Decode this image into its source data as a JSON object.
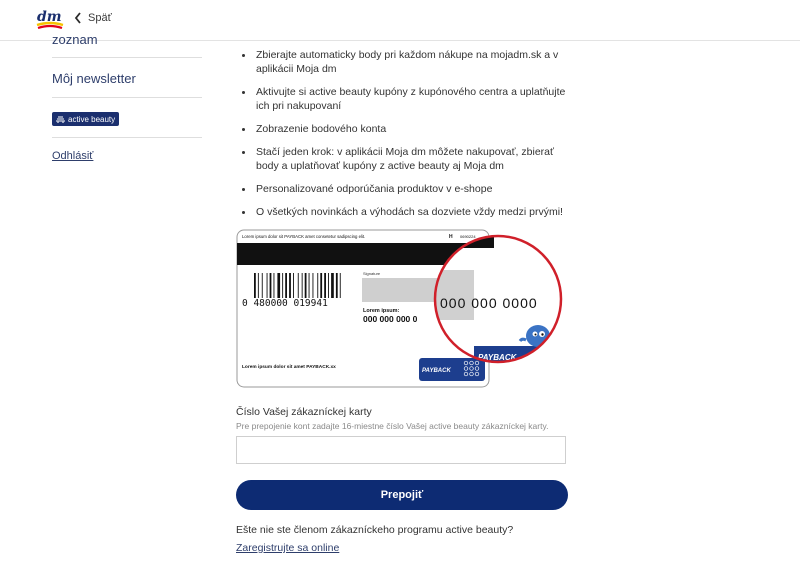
{
  "header": {
    "back_label": "Späť"
  },
  "sidebar": {
    "cut_item_label": "zoznam",
    "newsletter_label": "Môj newsletter",
    "badge_label": "active beauty",
    "logout_label": "Odhlásiť"
  },
  "benefits": [
    "Zbierajte automaticky body pri každom nákupe na mojadm.sk a v aplikácii Moja dm",
    "Aktivujte si active beauty kupóny z kupónového centra a uplatňujte ich pri nakupovaní",
    "Zobrazenie bodového konta",
    "Stačí jeden krok: v aplikácii Moja dm môžete nakupovať, zbierať body a uplatňovať kupóny z active beauty aj Moja dm",
    "Personalizované odporúčania produktov v e-shope",
    "O všetkých novinkách a výhodách sa dozviete vždy medzi prvými!"
  ],
  "card": {
    "top_text": "Lorem ipsum dolor sit PAYBACK amet consetetur sadipscing elit.",
    "top_letter": "H",
    "top_code": "0690224",
    "signature_label": "Signature",
    "barcode_number": "0 480000 019941",
    "lorem_label": "Lorem ipsum:",
    "small_number": "000 000 000 0",
    "footer_text": "Lorem ipsum dolor sit amet PAYBACK.xx",
    "payback_logo": "PAYBACK",
    "zoom_number": "000 000 0000",
    "zoom_strip_text": "PAYBACK"
  },
  "form": {
    "field_label": "Číslo Vašej zákazníckej karty",
    "field_help": "Pre prepojenie kont zadajte 16-miestne číslo Vašej active beauty zákazníckej karty.",
    "field_value": "",
    "field_placeholder": "",
    "submit_label": "Prepojiť",
    "member_question": "Ešte nie ste členom zákazníckeho programu active beauty?",
    "register_link": "Zaregistrujte sa online"
  },
  "colors": {
    "brand_navy": "#0d2b73",
    "zoom_ring": "#d0202a",
    "logo_red": "#e2001a",
    "logo_yellow": "#f6c300"
  },
  "icons": {
    "logo": "dm-logo",
    "back": "chevron-left-icon",
    "badge": "active-beauty-icon",
    "mascot": "payback-mascot"
  }
}
